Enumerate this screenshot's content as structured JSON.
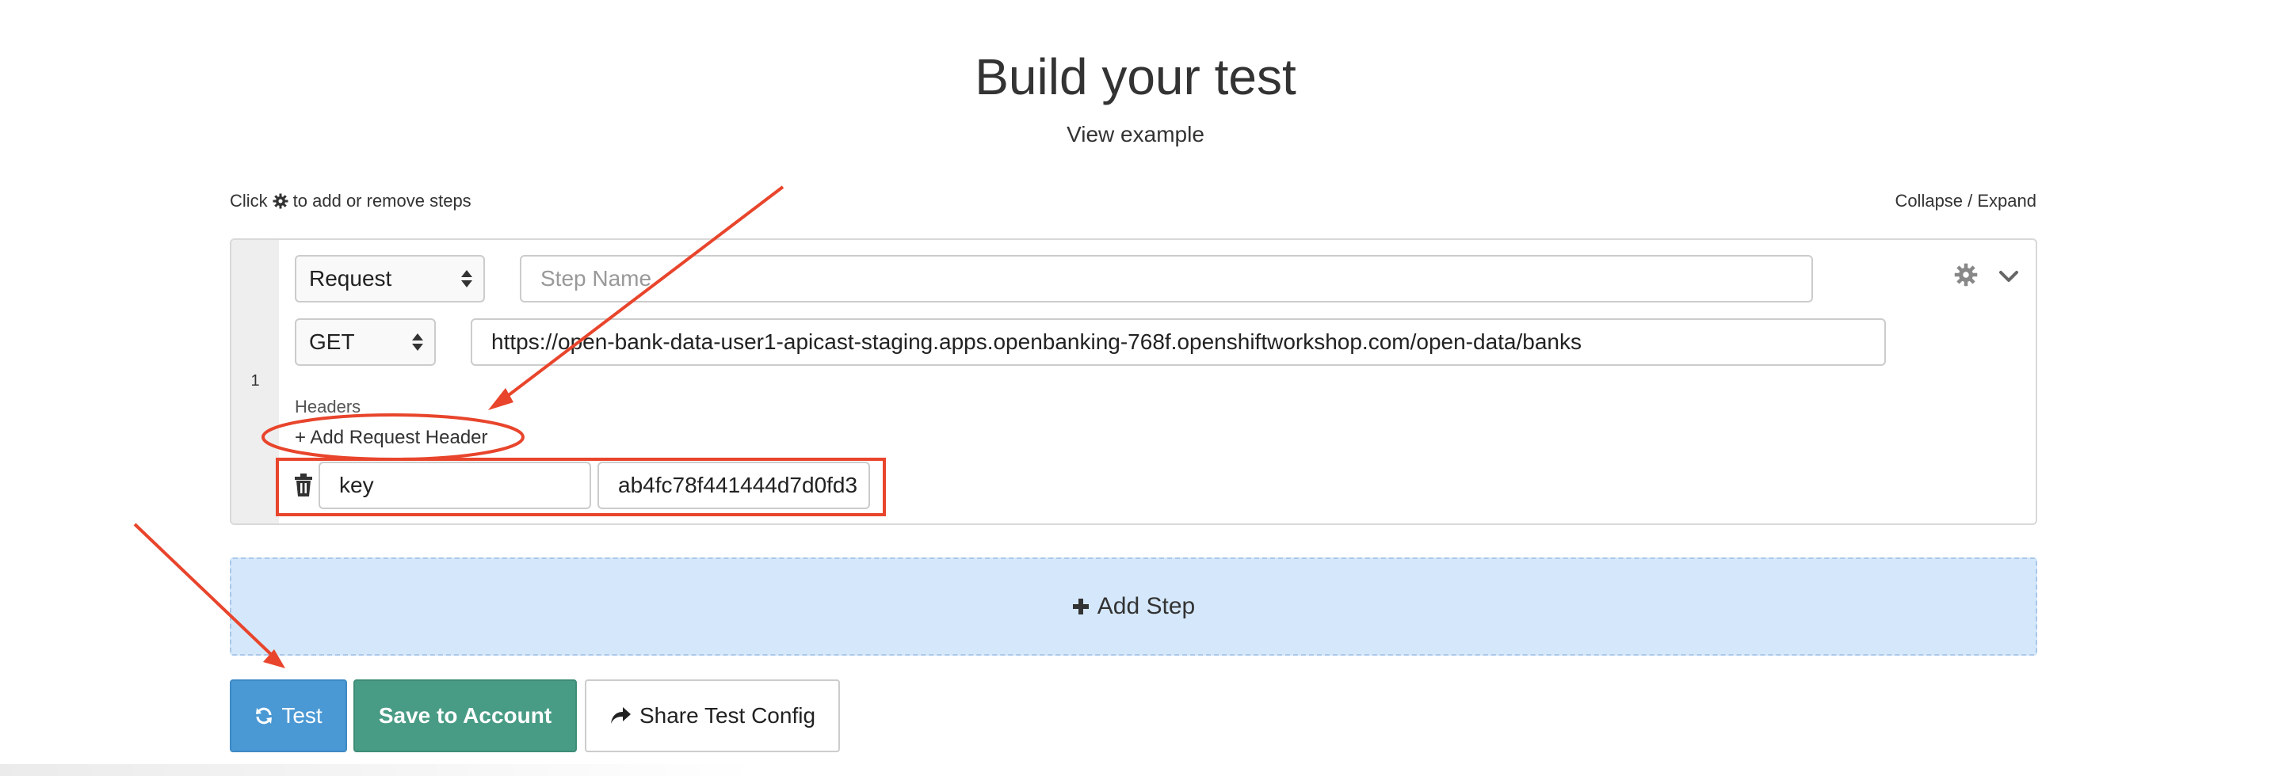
{
  "heading": {
    "title": "Build your test",
    "view_example": "View example"
  },
  "hint": {
    "prefix": "Click",
    "icon": "gear-icon",
    "suffix": "to add or remove steps",
    "collapse_expand": "Collapse / Expand"
  },
  "step": {
    "number": "1",
    "type_selected": "Request",
    "step_name_placeholder": "Step Name",
    "step_name_value": "",
    "method_selected": "GET",
    "url_value": "https://open-bank-data-user1-apicast-staging.apps.openbanking-768f.openshiftworkshop.com/open-data/banks",
    "headers_label": "Headers",
    "add_header_label": "+ Add Request Header",
    "header_key": "key",
    "header_value": "ab4fc78f441444d7d0fd3"
  },
  "add_step_label": "Add Step",
  "buttons": {
    "test_label": "Test",
    "save_label": "Save to Account",
    "share_label": "Share Test Config"
  },
  "colors": {
    "test_button": "#4a98d4",
    "save_button": "#489b84",
    "add_step_bg": "#d5e8fb",
    "annotation": "#e8452c"
  }
}
